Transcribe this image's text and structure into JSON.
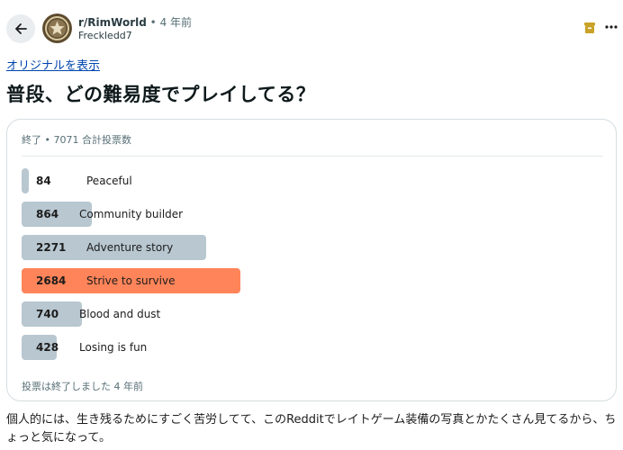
{
  "header": {
    "subreddit": "r/RimWorld",
    "meta": "• 4 年前",
    "username": "Freckledd7"
  },
  "show_original_link": "オリジナルを表示",
  "post_title": "普段、どの難易度でプレイしてる？",
  "poll": {
    "status": "終了 • 7071 合計投票数",
    "closed_text": "投票は終了しました 4 年前",
    "options": [
      {
        "votes": "84",
        "label": "Peaceful",
        "fraction": 0.013
      },
      {
        "votes": "864",
        "label": "Community builder",
        "fraction": 0.122
      },
      {
        "votes": "2271",
        "label": "Adventure story",
        "fraction": 0.321
      },
      {
        "votes": "2684",
        "label": "Strive to survive",
        "fraction": 0.38,
        "winner": true
      },
      {
        "votes": "740",
        "label": "Blood and dust",
        "fraction": 0.105
      },
      {
        "votes": "428",
        "label": "Losing is fun",
        "fraction": 0.061
      }
    ],
    "bar_color": "#b8c7d0",
    "winner_color": "#ff8459"
  },
  "body_text": "個人的には、生き残るためにすごく苦労してて、このRedditでレイトゲーム装備の写真とかたくさん見てるから、ちょっと気になって。",
  "icons": [
    "back-arrow-icon",
    "subreddit-avatar-icon",
    "award-icon",
    "more-options-icon"
  ]
}
